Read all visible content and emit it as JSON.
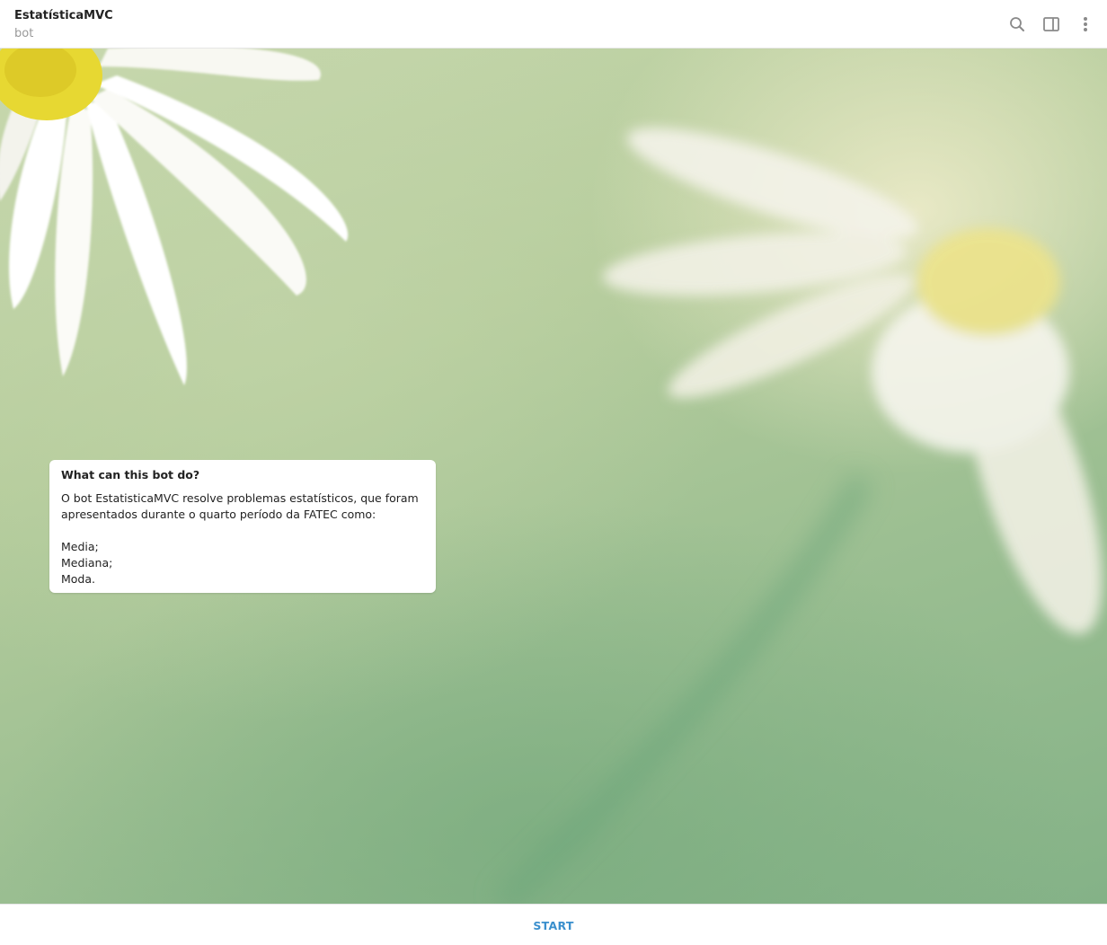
{
  "header": {
    "title": "EstatísticaMVC",
    "subtitle": "bot",
    "icons": [
      "search-icon",
      "sidebar-toggle-icon",
      "more-vertical-icon"
    ]
  },
  "bot_info": {
    "title": "What can this bot do?",
    "description": "O bot EstatisticaMVC resolve problemas estatísticos, que foram\napresentados durante o quarto período da FATEC como:\n\nMedia;\nMediana;\nModa."
  },
  "footer": {
    "start_label": "START"
  },
  "colors": {
    "accent": "#3a8fcd",
    "wallpaper": "#a9c79a"
  }
}
